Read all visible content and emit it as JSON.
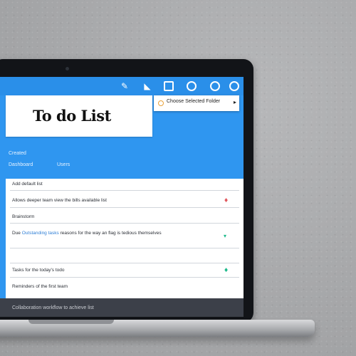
{
  "app": {
    "title": "To do List"
  },
  "toolbar": {
    "icons": [
      "pencil-icon",
      "tag-icon",
      "window-icon",
      "circle-icon",
      "circle-icon",
      "info-icon"
    ]
  },
  "popup": {
    "text": "Choose Selected Folder"
  },
  "meta": {
    "label_top": "Created",
    "label_left": "Dashboard",
    "label_right": "Users"
  },
  "list": {
    "items": [
      {
        "text": "Add default list",
        "link": "",
        "mark": ""
      },
      {
        "text": "Allows deeper team view the bills available list",
        "link": "",
        "mark": "♦"
      },
      {
        "text": "Brainstorm",
        "link": "",
        "mark": ""
      },
      {
        "text": "Due",
        "link": "Outstanding tasks",
        "rest": "reasons for the way an flag is tedious themselves",
        "mark": "▾"
      },
      {
        "text": "",
        "link": "",
        "mark": ""
      },
      {
        "text": "Tasks for the today's todo",
        "link": "",
        "mark": "♦"
      },
      {
        "text": "Reminders of the first team",
        "link": "",
        "mark": ""
      }
    ]
  },
  "footer": {
    "text": "Collaboration workflow to achieve list"
  },
  "colors": {
    "screen": "#2f96f0",
    "bar": "#3c4049",
    "red_mark": "#e0565b",
    "green_mark": "#1bb98a"
  }
}
